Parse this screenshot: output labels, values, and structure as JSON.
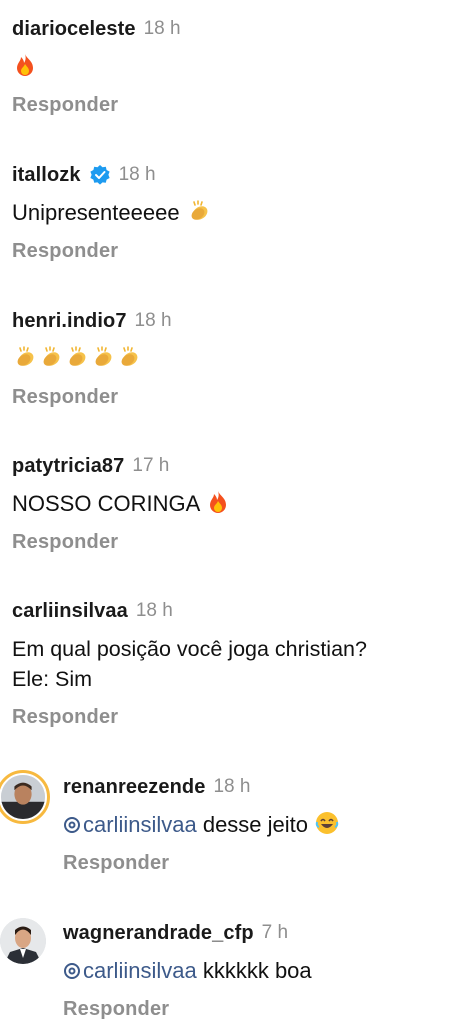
{
  "comments": [
    {
      "user": "diarioceleste",
      "time": "18 h",
      "text": "",
      "emoji": [
        "fire-icon"
      ],
      "reply": "Responder"
    },
    {
      "user": "itallozk",
      "time": "18 h",
      "text": "Unipresenteeeee",
      "emoji": [
        "clap-icon"
      ],
      "reply": "Responder"
    },
    {
      "user": "henri.indio7",
      "time": "18 h",
      "text": "",
      "emoji": [
        "clap-icon",
        "clap-icon",
        "clap-icon",
        "clap-icon",
        "clap-icon"
      ],
      "reply": "Responder"
    },
    {
      "user": "patytricia87",
      "time": "17 h",
      "text": "NOSSO CORINGA",
      "emoji": [
        "fire-icon"
      ],
      "reply": "Responder"
    },
    {
      "user": "carliinsilvaa",
      "time": "18 h",
      "text_line1": "Em qual posição você joga christian?",
      "text_line2": "Ele: Sim",
      "reply": "Responder"
    }
  ],
  "replies": [
    {
      "user": "renanreezende",
      "time": "18 h",
      "mention": "carliinsilvaa",
      "text": " desse jeito ",
      "emoji": [
        "laugh-icon"
      ],
      "reply": "Responder"
    },
    {
      "user": "wagnerandrade_cfp",
      "time": "7 h",
      "mention": "carliinsilvaa",
      "text": " kkkkkk boa",
      "reply": "Responder"
    }
  ],
  "colors": {
    "username": "#1a1a1a",
    "meta": "#8e8e8e",
    "mention": "#3d5a8a",
    "verified": "#1d9bf0",
    "story_ring": "#f7b93f"
  }
}
